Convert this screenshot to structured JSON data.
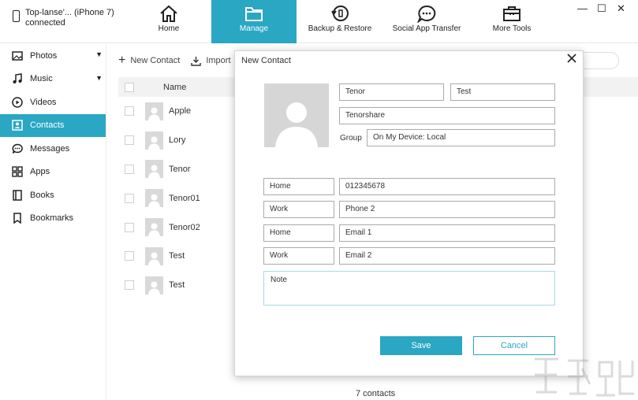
{
  "device": {
    "name": "Top-lanse'... (iPhone 7)",
    "status": "connected"
  },
  "nav": [
    {
      "label": "Home",
      "icon": "home-icon"
    },
    {
      "label": "Manage",
      "icon": "folder-icon"
    },
    {
      "label": "Backup & Restore",
      "icon": "restore-icon"
    },
    {
      "label": "Social App Transfer",
      "icon": "chat-bubble-icon"
    },
    {
      "label": "More Tools",
      "icon": "toolbox-icon"
    }
  ],
  "window_controls": {
    "minimize": "—",
    "maximize": "☐",
    "close": "✕"
  },
  "sidebar": [
    {
      "label": "Photos",
      "icon": "photo-icon",
      "expandable": true
    },
    {
      "label": "Music",
      "icon": "music-note-icon",
      "expandable": true
    },
    {
      "label": "Videos",
      "icon": "play-circle-icon",
      "expandable": false
    },
    {
      "label": "Contacts",
      "icon": "contact-card-icon",
      "expandable": false,
      "active": true
    },
    {
      "label": "Messages",
      "icon": "message-icon",
      "expandable": false
    },
    {
      "label": "Apps",
      "icon": "apps-grid-icon",
      "expandable": false
    },
    {
      "label": "Books",
      "icon": "book-icon",
      "expandable": false
    },
    {
      "label": "Bookmarks",
      "icon": "bookmark-icon",
      "expandable": false
    }
  ],
  "toolbar": {
    "new_contact": "New Contact",
    "import": "Import"
  },
  "list": {
    "header_name": "Name",
    "contacts": [
      "Apple",
      "Lory",
      "Tenor",
      "Tenor01",
      "Tenor02",
      "Test",
      "Test"
    ],
    "count": "7 contacts"
  },
  "dialog": {
    "title": "New Contact",
    "first_name": "Tenor",
    "last_name": "Test",
    "company": "Tenorshare",
    "group_label": "Group",
    "group_value": "On My Device: Local",
    "phones": [
      {
        "type": "Home",
        "value": "012345678"
      },
      {
        "type": "Work",
        "value": "Phone 2"
      }
    ],
    "emails": [
      {
        "type": "Home",
        "value": "Email 1"
      },
      {
        "type": "Work",
        "value": "Email 2"
      }
    ],
    "note_placeholder": "Note",
    "save_label": "Save",
    "cancel_label": "Cancel"
  },
  "colors": {
    "accent": "#2aa7c3"
  }
}
